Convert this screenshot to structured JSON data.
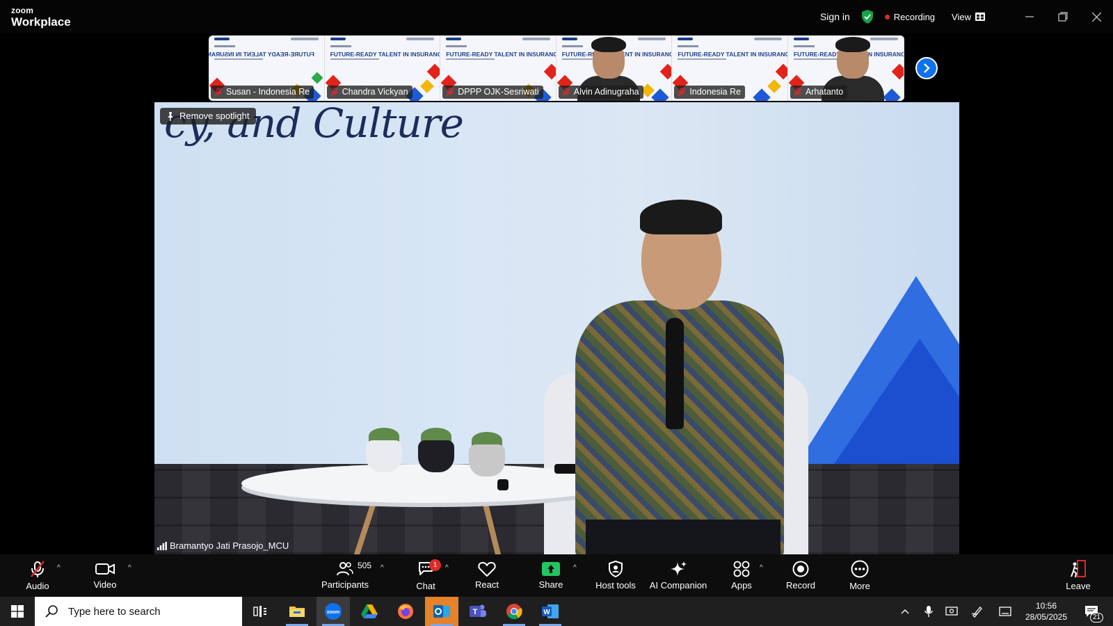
{
  "titlebar": {
    "logo_top": "zoom",
    "logo_bottom": "Workplace",
    "sign_in": "Sign in",
    "recording": "Recording",
    "view": "View"
  },
  "thumbnails": [
    {
      "name": "Susan - Indonesia Re",
      "slide_title": "FUTURE-READY TALENT IN INSURANCE",
      "mirrored": true,
      "muted": true
    },
    {
      "name": "Chandra Vickyan",
      "slide_title": "FUTURE-READY TALENT IN INSURANCE",
      "mirrored": false,
      "muted": true
    },
    {
      "name": "DPPP OJK-Sesriwati",
      "slide_title": "FUTURE-READY TALENT IN INSURANCE",
      "mirrored": false,
      "muted": true
    },
    {
      "name": "Alvin Adinugraha",
      "slide_title": "FUTURE-READY TALENT IN INSURANCE",
      "mirrored": false,
      "muted": true
    },
    {
      "name": "Indonesia Re",
      "slide_title": "FUTURE-READY TALENT IN INSURANCE",
      "mirrored": false,
      "muted": true
    },
    {
      "name": "Arhatanto",
      "slide_title": "FUTURE-READY TALENT IN INSURANCE",
      "mirrored": false,
      "muted": true
    }
  ],
  "main_video": {
    "spotlight_label": "Remove spotlight",
    "background_script": "cy, and Culture",
    "speaker_name": "Bramantyo Jati Prasojo_MCU"
  },
  "controls": {
    "audio": "Audio",
    "video": "Video",
    "participants": "Participants",
    "participants_count": "505",
    "chat": "Chat",
    "chat_badge": "1",
    "react": "React",
    "share": "Share",
    "host_tools": "Host tools",
    "ai_companion": "AI Companion",
    "apps": "Apps",
    "record": "Record",
    "more": "More",
    "leave": "Leave"
  },
  "taskbar": {
    "search_placeholder": "Type here to search",
    "time": "10:56",
    "date": "28/05/2025",
    "notifications": "21"
  },
  "colors": {
    "zoom_blue": "#0e72ed",
    "record_red": "#e02828",
    "share_green": "#22c55e",
    "shield_green": "#16a34a"
  }
}
